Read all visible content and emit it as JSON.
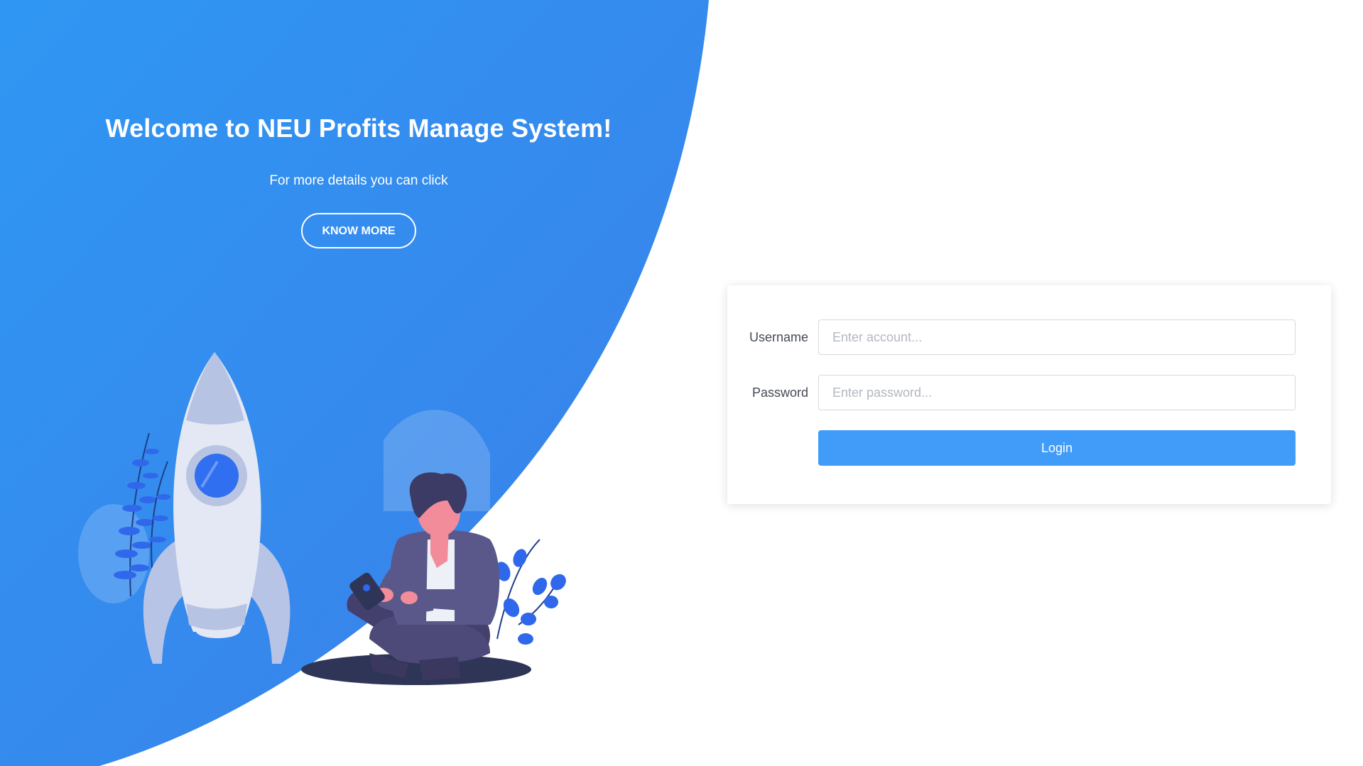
{
  "hero": {
    "title": "Welcome to NEU Profits Manage System!",
    "subtitle": "For more details you can click",
    "know_more_label": "KNOW MORE",
    "gradient_start": "#2f95f2",
    "gradient_end": "#3a7fe9"
  },
  "illustration": {
    "rocket": "rocket-illustration",
    "person": "person-with-phone-illustration",
    "plants": "leaf-plant-illustration"
  },
  "login": {
    "username_label": "Username",
    "username_placeholder": "Enter account...",
    "password_label": "Password",
    "password_placeholder": "Enter password...",
    "login_label": "Login",
    "accent_color": "#409cf8"
  }
}
